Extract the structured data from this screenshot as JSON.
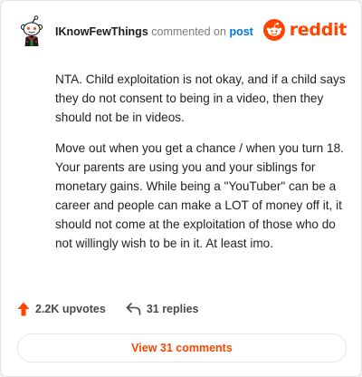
{
  "comment": {
    "username": "IKnowFewThings",
    "commented_on_text": "commented on",
    "post_link_text": "post",
    "paragraphs": [
      "NTA. Child exploitation is not okay, and if a child says they do not consent to being in a video, then they should not be in videos.",
      "Move out when you get a chance / when you turn 18. Your parents are using you and your siblings for monetary gains. While being a \"YouTuber\" can be a career and people can make a LOT of money off it, it should not come at the exploitation of those who do not willingly wish to be in it. At least imo."
    ]
  },
  "brand": {
    "wordmark": "reddit",
    "icon": "reddit-logo-icon",
    "color": "#ff4500"
  },
  "stats": {
    "upvotes_label": "2.2K upvotes",
    "upvote_icon": "upvote-arrow-icon",
    "replies_label": "31 replies",
    "reply_icon": "reply-arrow-icon"
  },
  "actions": {
    "view_comments_label": "View 31 comments"
  },
  "colors": {
    "accent": "#ff4500",
    "link": "#0079d3",
    "text": "#1c1c1c",
    "muted": "#7c7c7c"
  }
}
